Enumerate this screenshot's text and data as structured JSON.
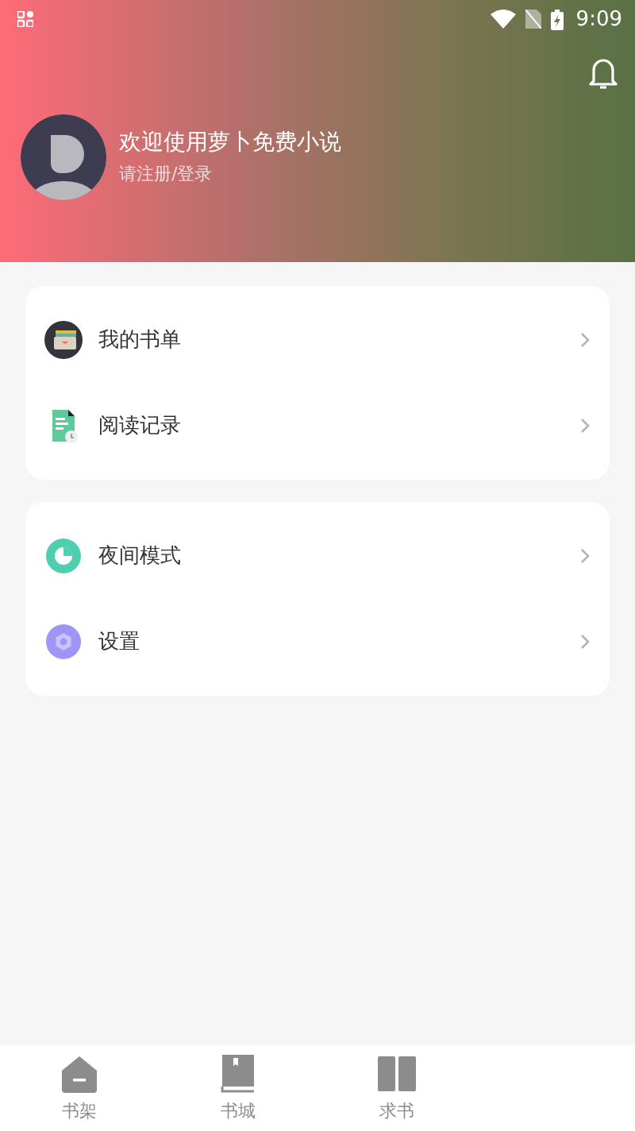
{
  "status_bar": {
    "time": "9:09"
  },
  "profile": {
    "title": "欢迎使用萝卜免费小说",
    "subtitle": "请注册/登录"
  },
  "menu_groups": [
    {
      "items": [
        {
          "label": "我的书单",
          "kind": "booklist"
        },
        {
          "label": "阅读记录",
          "kind": "history"
        }
      ]
    },
    {
      "items": [
        {
          "label": "夜间模式",
          "kind": "night"
        },
        {
          "label": "设置",
          "kind": "settings"
        }
      ]
    }
  ],
  "tabs": [
    {
      "label": "书架",
      "kind": "shelf",
      "selected": false
    },
    {
      "label": "书城",
      "kind": "store",
      "selected": false
    },
    {
      "label": "求书",
      "kind": "request",
      "selected": false
    }
  ]
}
